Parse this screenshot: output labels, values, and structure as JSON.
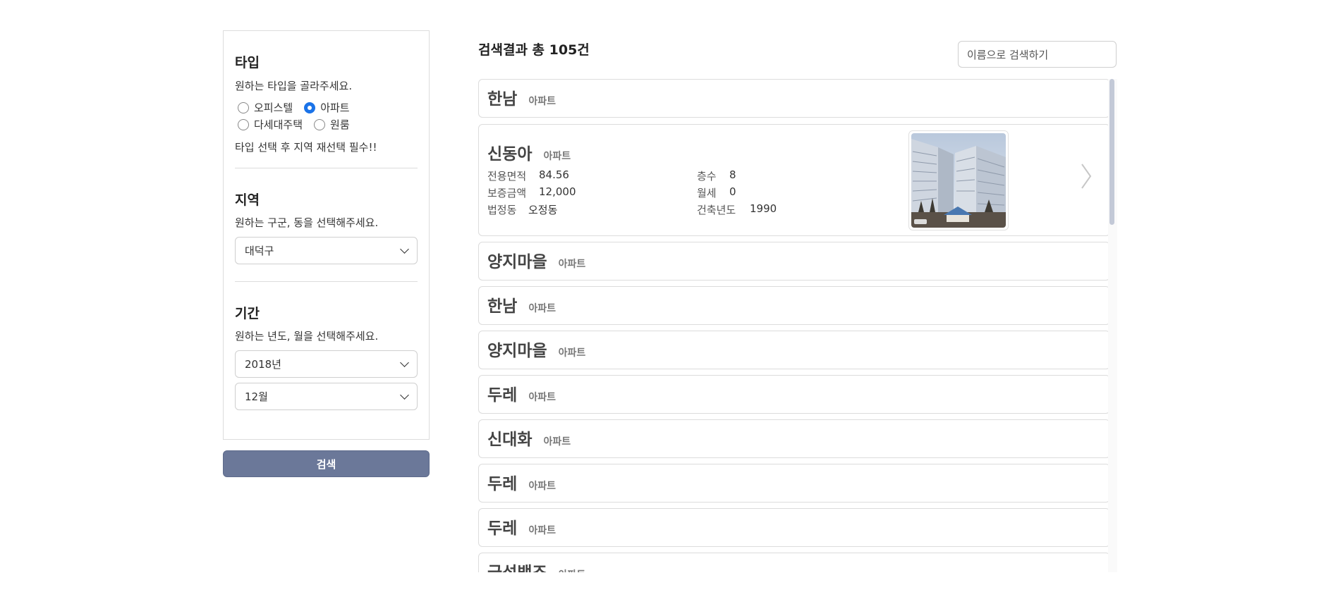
{
  "filters": {
    "type": {
      "title": "타입",
      "description": "원하는 타입을 골라주세요.",
      "options": [
        {
          "label": "오피스텔",
          "checked": false
        },
        {
          "label": "아파트",
          "checked": true
        },
        {
          "label": "다세대주택",
          "checked": false
        },
        {
          "label": "원룸",
          "checked": false
        }
      ],
      "notice": "타입 선택 후 지역 재선택 필수!!"
    },
    "region": {
      "title": "지역",
      "description": "원하는 구군, 동을 선택해주세요.",
      "selected": "대덕구"
    },
    "period": {
      "title": "기간",
      "description": "원하는 년도, 월을 선택해주세요.",
      "year": "2018년",
      "month": "12월"
    },
    "search_button": "검색"
  },
  "results": {
    "count_label": "검색결과 총 105건",
    "name_search_placeholder": "이름으로 검색하기",
    "items": [
      {
        "name": "한남",
        "type": "아파트"
      },
      {
        "name": "신동아",
        "type": "아파트",
        "details": {
          "area_label": "전용면적",
          "area": "84.56",
          "floor_label": "층수",
          "floor": "8",
          "deposit_label": "보증금액",
          "deposit": "12,000",
          "rent_label": "월세",
          "rent": "0",
          "dong_label": "법정동",
          "dong": "오정동",
          "year_label": "건축년도",
          "year": "1990"
        }
      },
      {
        "name": "양지마을",
        "type": "아파트"
      },
      {
        "name": "한남",
        "type": "아파트"
      },
      {
        "name": "양지마을",
        "type": "아파트"
      },
      {
        "name": "두레",
        "type": "아파트"
      },
      {
        "name": "신대화",
        "type": "아파트"
      },
      {
        "name": "두레",
        "type": "아파트"
      },
      {
        "name": "두레",
        "type": "아파트"
      },
      {
        "name": "금성백조",
        "type": "아파트"
      }
    ]
  },
  "colors": {
    "accent": "#1a73e8",
    "search_button_bg": "#6b7899",
    "border": "#dcdcdc",
    "scroll_thumb": "#c3c9d7"
  },
  "icons": {
    "dropdown": "chevron-down-icon",
    "next": "chevron-right-icon"
  }
}
